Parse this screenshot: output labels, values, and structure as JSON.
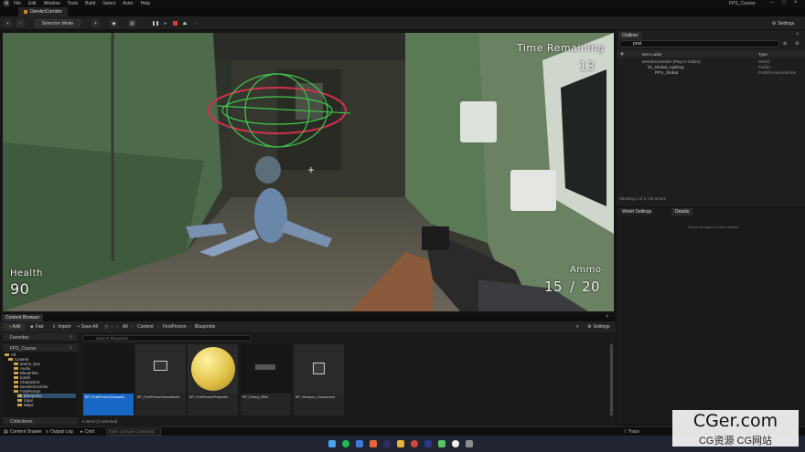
{
  "menubar": {
    "items": [
      "File",
      "Edit",
      "Window",
      "Tools",
      "Build",
      "Select",
      "Actor",
      "Help"
    ],
    "project": "FPS_Course"
  },
  "level_tab": "DerelictCorridor",
  "toolbar": {
    "selection_mode": "Selection Mode",
    "settings": "Settings"
  },
  "hud": {
    "time_label": "Time Remaining",
    "time_value": "13",
    "health_label": "Health",
    "health_value": "90",
    "ammo_label": "Ammo",
    "ammo_current": "15",
    "ammo_sep": "/",
    "ammo_total": "20"
  },
  "outliner": {
    "tab": "Outliner",
    "search_value": "post",
    "col_label": "Item Label",
    "col_type": "Type",
    "rows": [
      {
        "label": "DerelictCorridor (Play In Editor)",
        "type": "World"
      },
      {
        "label": "01_Global_Lighting",
        "type": "Folder"
      },
      {
        "label": "PPV_Global",
        "type": "PostProcessVolume"
      }
    ],
    "footer": "Showing 1 of 2,716 actors"
  },
  "details": {
    "tab_world": "World Settings",
    "tab_details": "Details",
    "hint": "Select an object to view details."
  },
  "content_browser": {
    "tab": "Content Browser",
    "add": "Add",
    "fab": "Fab",
    "import": "Import",
    "save_all": "Save All",
    "crumbs": [
      "All",
      "Content",
      "FirstPerson",
      "Blueprints"
    ],
    "settings": "Settings",
    "favorites": "Favorites",
    "project": "FPS_Course",
    "search_placeholder": "Search Blueprints",
    "tree": [
      "All",
      "Content",
      "ammo_box",
      "Audio",
      "Blueprints",
      "bomb",
      "Characters",
      "DerelictCorridor",
      "FirstPerson",
      "Blueprints",
      "Input",
      "Maps"
    ],
    "collections": "Collections",
    "assets": [
      "BP_FirstPersonCharacter",
      "BP_FirstPersonGameMode",
      "BP_FirstPersonProjectile",
      "BP_Pickup_Rifle",
      "BP_Weapon_Component"
    ],
    "items_count": "5 items (1 selected)"
  },
  "statusbar": {
    "content_drawer": "Content Drawer",
    "output_log": "Output Log",
    "cmd": "Cmd",
    "cmd_placeholder": "Enter Console Command",
    "trace": "Trace"
  },
  "watermark": {
    "main": "CGer.com",
    "sub": "CG资源 CG网站"
  },
  "colors": {
    "accent_blue": "#1766c4",
    "hud_text": "#f2f2f2",
    "folder": "#c9a44a"
  }
}
